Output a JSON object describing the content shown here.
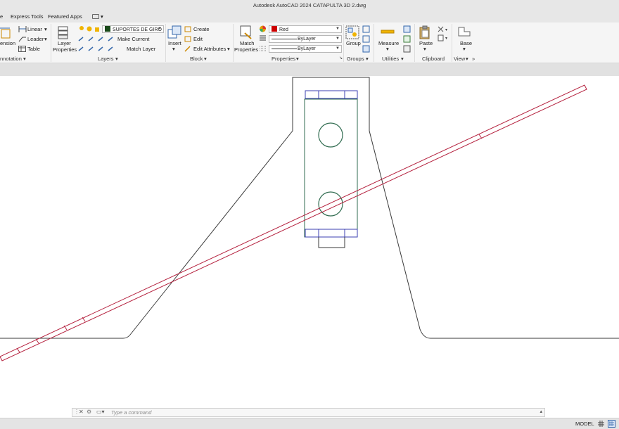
{
  "window": {
    "title": "Autodesk AutoCAD 2024    CATAPULTA 3D 2.dwg"
  },
  "menu": {
    "items": [
      {
        "label": "e"
      },
      {
        "label": "Express Tools"
      },
      {
        "label": "Featured Apps"
      }
    ]
  },
  "ribbon": {
    "annotation": {
      "dimension_label": "ension",
      "linear_label": "Linear",
      "leader_label": "Leader",
      "table_label": "Table",
      "panel_title": "nnotation"
    },
    "layers": {
      "layer_properties_label_1": "Layer",
      "layer_properties_label_2": "Properties",
      "current_layer": "SUPORTES DE GIRO",
      "make_current_label": "Make Current",
      "match_layer_label": "Match Layer",
      "panel_title": "Layers"
    },
    "block": {
      "insert_label": "Insert",
      "create_label": "Create",
      "edit_label": "Edit",
      "edit_attributes_label": "Edit Attributes",
      "panel_title": "Block"
    },
    "properties": {
      "match_properties_label_1": "Match",
      "match_properties_label_2": "Properties",
      "color_value": "Red",
      "linetype_value": "ByLayer",
      "lineweight_value": "ByLayer",
      "panel_title": "Properties"
    },
    "groups": {
      "group_label": "Group",
      "panel_title": "Groups"
    },
    "utilities": {
      "measure_label": "Measure",
      "panel_title": "Utilities"
    },
    "clipboard": {
      "paste_label": "Paste",
      "panel_title": "Clipboard"
    },
    "view": {
      "base_label": "Base",
      "panel_title": "View"
    }
  },
  "command": {
    "placeholder": "Type a command"
  },
  "status": {
    "model_label": "MODEL"
  },
  "colors": {
    "accent_red": "#cc0000",
    "layer_swatch": "#1a4a1a",
    "green_lines": "#2f6b4f",
    "blue_lines": "#3b3fb0",
    "red_lines": "#b5223f"
  }
}
